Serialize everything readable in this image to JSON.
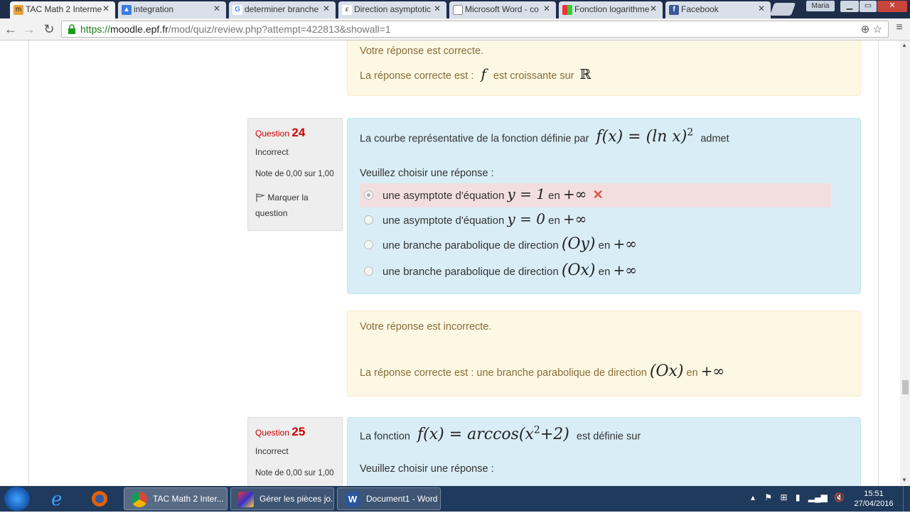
{
  "browser": {
    "tabs": [
      {
        "label": "TAC Math 2 Interme",
        "icon": "moodle-icon",
        "active": true
      },
      {
        "label": "integration",
        "icon": "maps-icon"
      },
      {
        "label": "determiner branche",
        "icon": "google-icon"
      },
      {
        "label": "Direction asymptotic",
        "icon": "document-icon"
      },
      {
        "label": "Microsoft Word - co",
        "icon": "page-icon"
      },
      {
        "label": "Fonction logarithme",
        "icon": "colorful-icon"
      },
      {
        "label": "Facebook",
        "icon": "facebook-icon"
      }
    ],
    "user": "Maria",
    "url": {
      "scheme": "https://",
      "host": "moodle.epf.fr",
      "path": "/mod/quiz/review.php?attempt=422813&showall=1"
    }
  },
  "prev_feedback": {
    "correct_text": "Votre réponse est correcte.",
    "answer_prefix": "La réponse correcte est :",
    "answer_f": "f",
    "answer_mid": "est croissante sur",
    "answer_set": "ℝ"
  },
  "q24": {
    "label": "Question",
    "number": "24",
    "state": "Incorrect",
    "grade": "Note de 0,00 sur 1,00",
    "flag_label": "Marquer la question",
    "stem_prefix": "La courbe représentative de la fonction définie par",
    "stem_math": "f(x) = (ln x)",
    "stem_exp": "2",
    "stem_suffix": "admet",
    "prompt": "Veuillez choisir une réponse :",
    "answers": [
      {
        "text": "une asymptote d'équation",
        "math": "y = 1",
        "suffix": "en",
        "limit": "+∞",
        "checked": true,
        "wrong": true
      },
      {
        "text": "une asymptote d'équation",
        "math": "y = 0",
        "suffix": "en",
        "limit": "+∞"
      },
      {
        "text": "une branche parabolique de direction",
        "math": "(Oy)",
        "suffix": "en",
        "limit": "+∞"
      },
      {
        "text": "une branche parabolique de direction",
        "math": "(Ox)",
        "suffix": "en",
        "limit": "+∞"
      }
    ],
    "wrong_mark": "✕"
  },
  "q24_feedback": {
    "incorrect_text": "Votre réponse est incorrecte.",
    "answer_prefix": "La réponse correcte est : une branche parabolique de direction",
    "answer_math": "(Ox)",
    "answer_suffix": "en",
    "answer_limit": "+∞"
  },
  "q25": {
    "label": "Question",
    "number": "25",
    "state": "Incorrect",
    "grade": "Note de 0,00 sur 1,00",
    "stem_prefix": "La fonction",
    "stem_math_a": "f(x) = arccos(x",
    "stem_exp": "2",
    "stem_math_b": "+2)",
    "stem_suffix": "est définie sur",
    "prompt": "Veuillez choisir une réponse :"
  },
  "taskbar": {
    "apps": [
      {
        "label": "TAC Math 2 Inter...",
        "active": true
      },
      {
        "label": "Gérer les pièces jo..."
      },
      {
        "label": "Document1 - Word"
      }
    ],
    "time": "15:51",
    "date": "27/04/2016"
  },
  "colors": {
    "feedback_bg": "#fcf8e3",
    "formulation_bg": "#d9edf7",
    "wrong_bg": "#f2dede",
    "question_number": "#cc0000",
    "url_host": "#1a7f1a"
  }
}
